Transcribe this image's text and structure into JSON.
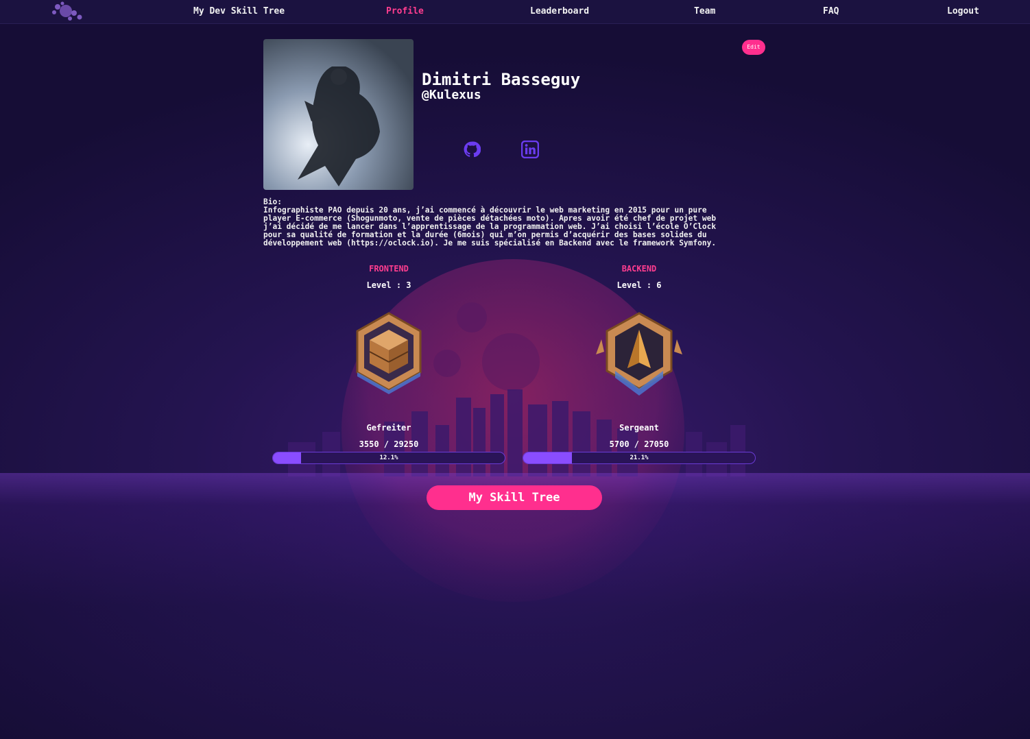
{
  "nav": {
    "links": [
      "My Dev Skill Tree",
      "Profile",
      "Leaderboard",
      "Team",
      "FAQ",
      "Logout"
    ],
    "active": "Profile"
  },
  "profile": {
    "edit_label": "Edit",
    "name": "Dimitri Basseguy",
    "handle": "@Kulexus",
    "social": [
      "github-icon",
      "linkedin-icon"
    ],
    "bio": "Bio:\nInfographiste PAO depuis 20 ans, j’ai commencé à découvrir le web marketing en 2015 pour un pure\nplayer E-commerce (Shogunmoto, vente de pièces détachées moto). Apres avoir été chef de projet web\nj’ai décidé de me lancer dans l’apprentissage de la programmation web. J’ai choisi l’école O’Clock\npour sa qualité de formation et la durée (6mois) qui m’on permis d’acquérir des bases solides du\ndéveloppement web (https://oclock.io). Je me suis spécialisé en Backend avec le framework Symfony."
  },
  "skills": [
    {
      "category": "FRONTEND",
      "level": "Level : 3",
      "badge": "crate-badge-icon",
      "rank": "Gefreiter",
      "xp": "3550 / 29250",
      "progress_label": "12.1%",
      "progress": 0.121
    },
    {
      "category": "BACKEND",
      "level": "Level : 6",
      "badge": "arrow-badge-icon",
      "rank": "Sergeant",
      "xp": "5700 / 27050",
      "progress_label": "21.1%",
      "progress": 0.211
    }
  ],
  "cta": {
    "label": "My Skill Tree"
  },
  "colors": {
    "accent": "#ff2f8e",
    "progress": "#8a4dff",
    "nav_bg": "#1b1240"
  }
}
